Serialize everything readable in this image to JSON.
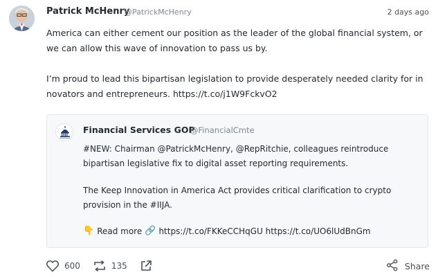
{
  "post": {
    "author_name": "Patrick McHenry",
    "author_handle": "@PatrickMcHenry",
    "timestamp": "2 days ago",
    "lines": [
      "America can either cement our position as the leader of the global financial system, or",
      "we can allow this wave of innovation to pass us by.",
      "I’m proud to lead this bipartisan legislation to provide desperately needed clarity for in",
      "novators and entrepreneurs. https://t.co/j1W9FckvO2"
    ]
  },
  "quote": {
    "author_name": "Financial Services GOP",
    "author_handle": "@FinancialCmte",
    "lines": [
      "#NEW: Chairman @PatrickMcHenry, @RepRitchie, colleagues reintroduce",
      "bipartisan legislative fix to digital asset reporting requirements.",
      "The Keep Innovation in America Act provides critical clarification to crypto",
      "provision in the #IIJA."
    ],
    "link_emoji": "👇",
    "read_more": "Read more",
    "chain_emoji": "🔗",
    "links": "https://t.co/FKKeCCHqGU https://t.co/UO6lUdBnGm"
  },
  "actions": {
    "likes": "600",
    "retweets": "135",
    "share_label": "Share"
  },
  "icons": {
    "like": "heart-icon",
    "retweet": "retweet-icon",
    "external": "external-link-icon",
    "share": "share-icon"
  }
}
